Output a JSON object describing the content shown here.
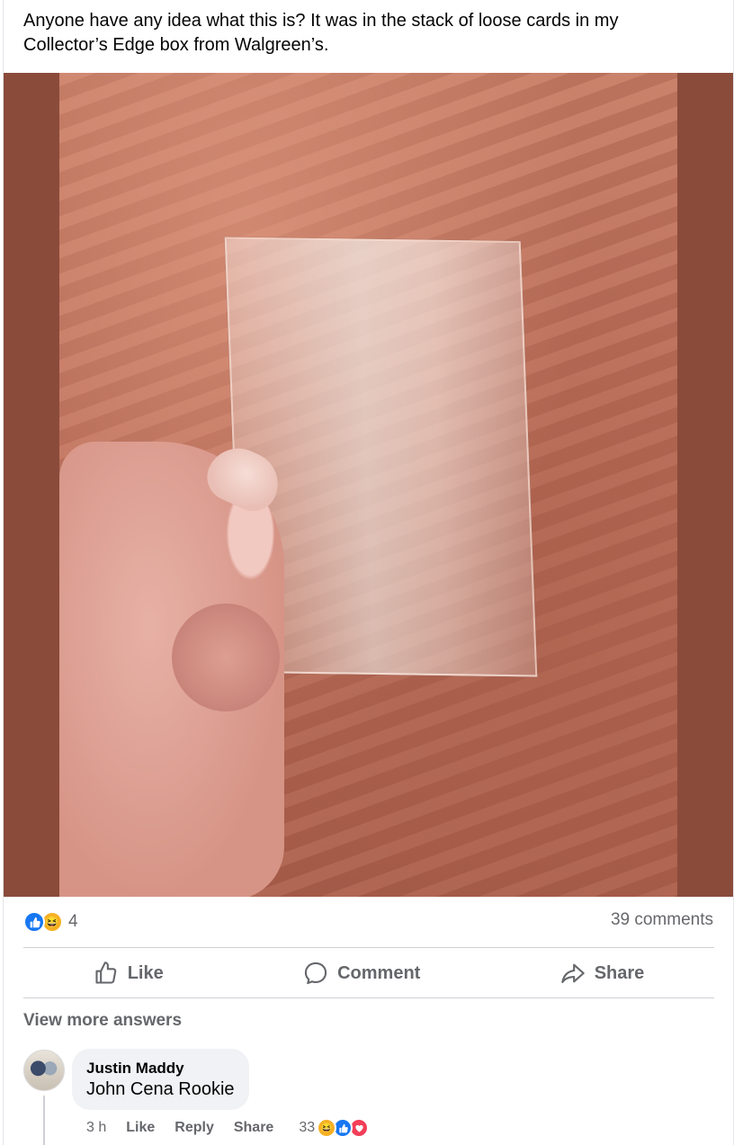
{
  "post": {
    "caption": "Anyone have any idea what this is? It was in the stack of loose cards in my Collector’s Edge box from Walgreen’s.",
    "reaction_icons": [
      "thumbs-up-icon",
      "haha-icon"
    ],
    "reaction_count": "4",
    "comments_count": "39 comments",
    "colors": {
      "like": "#1877f2",
      "haha": "#f7b125",
      "love": "#f33e58",
      "muted_text": "#65676b"
    }
  },
  "actions": {
    "like": "Like",
    "comment": "Comment",
    "share": "Share"
  },
  "thread": {
    "view_more": "View more answers",
    "comment": {
      "author": "Justin Maddy",
      "text": "John Cena Rookie",
      "time": "3 h",
      "like_label": "Like",
      "reply_label": "Reply",
      "share_label": "Share",
      "reaction_count": "33",
      "reaction_icons": [
        "haha-icon",
        "thumbs-up-icon",
        "heart-icon"
      ]
    }
  }
}
